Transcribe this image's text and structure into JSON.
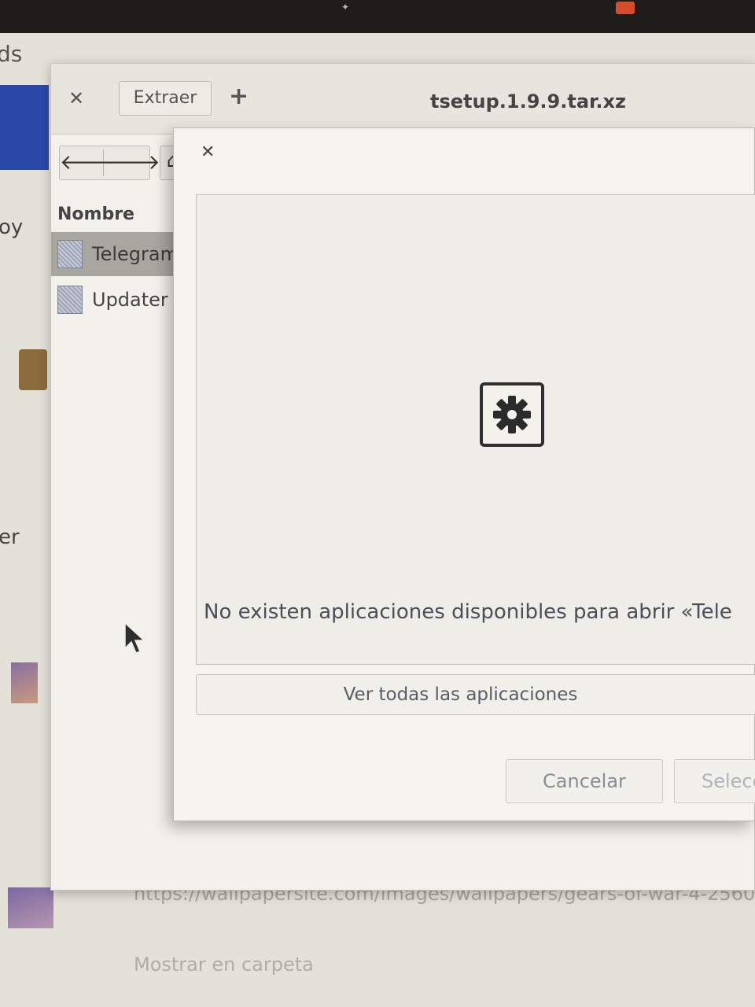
{
  "background_window": {
    "title_fragment": "ds",
    "side_text_1": "oy",
    "side_text_2": "er",
    "download_url": "https://wallpapersite.com/images/wallpapers/gears-of-war-4-2560",
    "show_in_folder_label": "Mostrar en carpeta"
  },
  "archive_manager": {
    "extract_label": "Extraer",
    "add_label": "+",
    "window_title": "tsetup.1.9.9.tar.xz",
    "column_header": "Nombre",
    "files": [
      {
        "name": "Telegram",
        "selected": true
      },
      {
        "name": "Updater",
        "selected": false
      }
    ]
  },
  "open_with_dialog": {
    "empty_message": "No existen aplicaciones disponibles para abrir «Tele",
    "icon": "gear-icon",
    "view_all_label": "Ver todas las aplicaciones",
    "cancel_label": "Cancelar",
    "select_label": "Selecc"
  }
}
